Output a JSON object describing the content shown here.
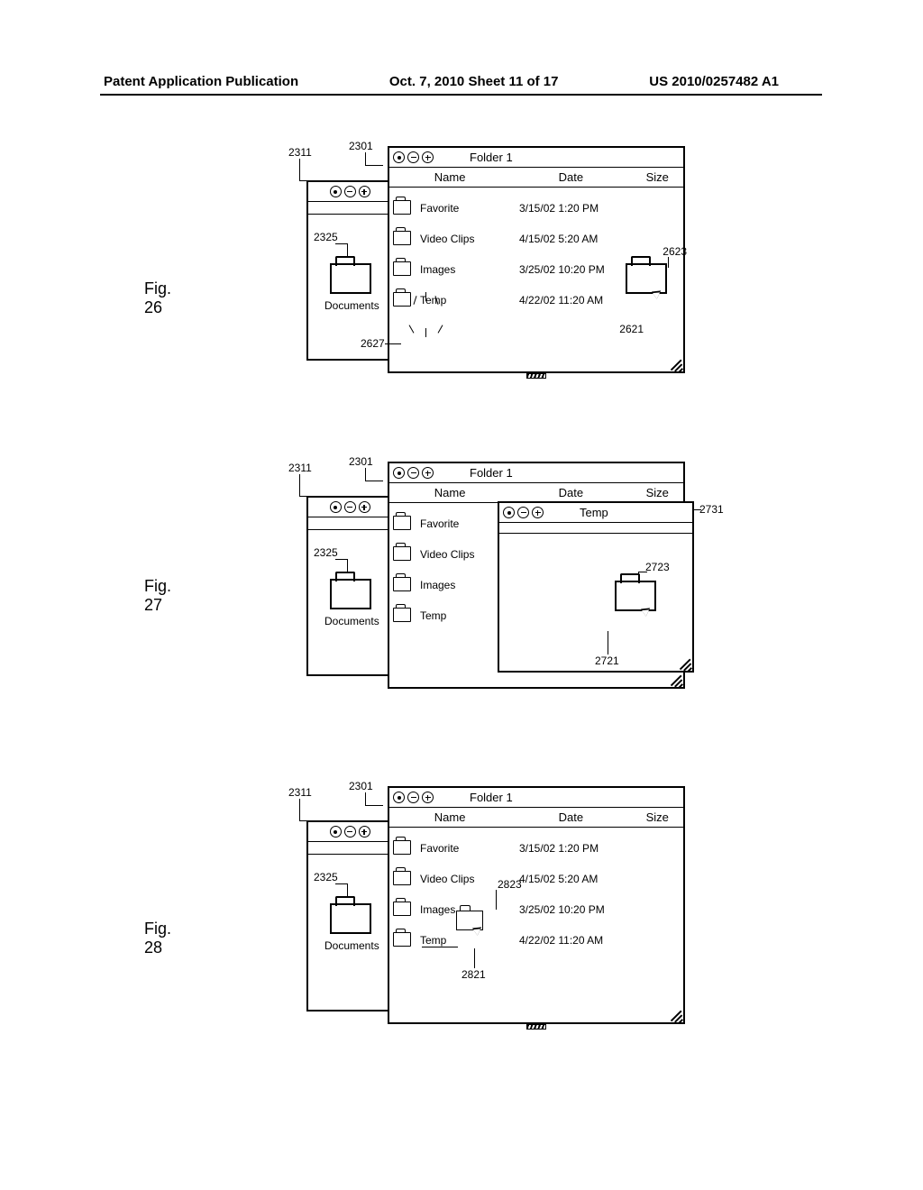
{
  "header": {
    "left": "Patent Application Publication",
    "center": "Oct. 7, 2010  Sheet 11 of 17",
    "right": "US 2010/0257482 A1"
  },
  "figs": {
    "f26": "Fig. 26",
    "f27": "Fig. 27",
    "f28": "Fig. 28"
  },
  "refs": {
    "r2301": "2301",
    "r2311": "2311",
    "r2325": "2325",
    "r2621": "2621",
    "r2623": "2623",
    "r2627": "2627",
    "r2721": "2721",
    "r2723": "2723",
    "r2731": "2731",
    "r2821": "2821",
    "r2823": "2823"
  },
  "sidebar": {
    "label": "Documents"
  },
  "main": {
    "title": "Folder 1",
    "cols": {
      "name": "Name",
      "date": "Date",
      "size": "Size"
    },
    "rows": [
      {
        "name": "Favorite",
        "date": "3/15/02 1:20 PM"
      },
      {
        "name": "Video Clips",
        "date": "4/15/02 5:20 AM"
      },
      {
        "name": "Images",
        "date": "3/25/02 10:20 PM"
      },
      {
        "name": "Temp",
        "date": "4/22/02 11:20 AM"
      }
    ]
  },
  "tempwin": {
    "title": "Temp"
  }
}
